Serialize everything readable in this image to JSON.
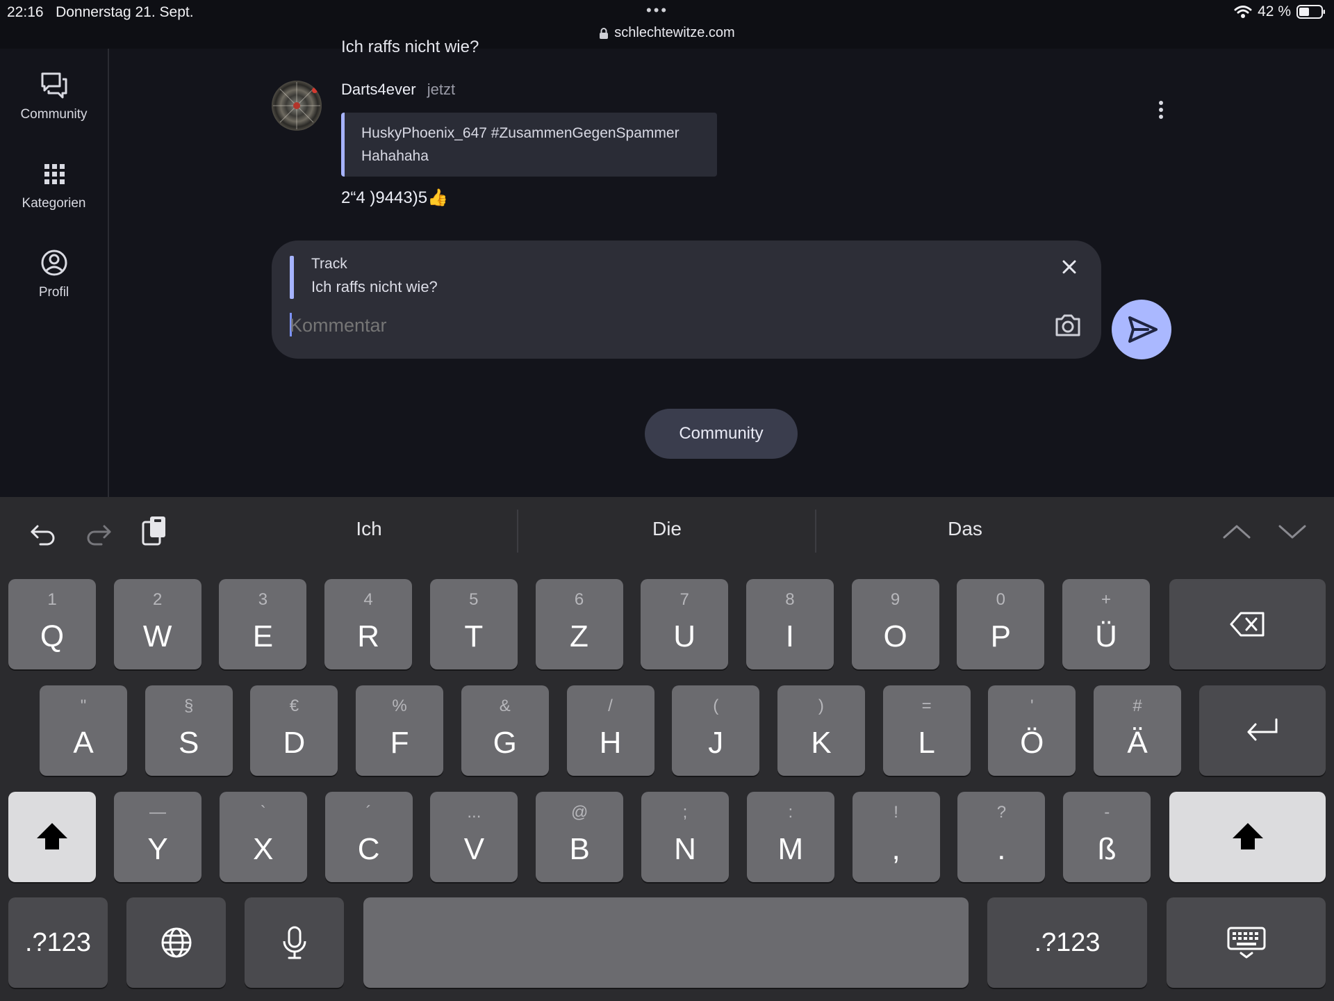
{
  "status": {
    "time": "22:16",
    "date": "Donnerstag 21. Sept.",
    "url": "schlechtewitze.com",
    "battery": "42 %"
  },
  "sidebar": {
    "items": [
      {
        "label": "Community",
        "icon": "forum-icon"
      },
      {
        "label": "Kategorien",
        "icon": "grid-icon"
      },
      {
        "label": "Profil",
        "icon": "account-circle-icon"
      }
    ]
  },
  "thread": {
    "cut_text": "Ich raffs nicht wie?",
    "comment": {
      "author": "Darts4ever",
      "time": "jetzt",
      "quote_line1": "HuskyPhoenix_647 #ZusammenGegenSpammer",
      "quote_line2": "Hahahaha",
      "body": "2“4 )9443)5👍"
    }
  },
  "composer": {
    "reply_to_user": "Track",
    "reply_to_text": "Ich raffs nicht wie?",
    "placeholder": "Kommentar"
  },
  "community_button": "Community",
  "keyboard": {
    "suggestions": [
      "Ich",
      "Die",
      "Das"
    ],
    "row1": [
      {
        "s": "1",
        "p": "Q"
      },
      {
        "s": "2",
        "p": "W"
      },
      {
        "s": "3",
        "p": "E"
      },
      {
        "s": "4",
        "p": "R"
      },
      {
        "s": "5",
        "p": "T"
      },
      {
        "s": "6",
        "p": "Z"
      },
      {
        "s": "7",
        "p": "U"
      },
      {
        "s": "8",
        "p": "I"
      },
      {
        "s": "9",
        "p": "O"
      },
      {
        "s": "0",
        "p": "P"
      },
      {
        "s": "+",
        "p": "Ü"
      }
    ],
    "row2": [
      {
        "s": "\"",
        "p": "A"
      },
      {
        "s": "§",
        "p": "S"
      },
      {
        "s": "€",
        "p": "D"
      },
      {
        "s": "%",
        "p": "F"
      },
      {
        "s": "&",
        "p": "G"
      },
      {
        "s": "/",
        "p": "H"
      },
      {
        "s": "(",
        "p": "J"
      },
      {
        "s": ")",
        "p": "K"
      },
      {
        "s": "=",
        "p": "L"
      },
      {
        "s": "'",
        "p": "Ö"
      },
      {
        "s": "#",
        "p": "Ä"
      }
    ],
    "row3": [
      {
        "s": "—",
        "p": "Y"
      },
      {
        "s": "`",
        "p": "X"
      },
      {
        "s": "´",
        "p": "C"
      },
      {
        "s": "...",
        "p": "V"
      },
      {
        "s": "@",
        "p": "B"
      },
      {
        "s": ";",
        "p": "N"
      },
      {
        "s": ":",
        "p": "M"
      },
      {
        "s": "!",
        "p": ","
      },
      {
        "s": "?",
        "p": "."
      },
      {
        "s": "-",
        "p": "ß"
      }
    ],
    "mode_key": ".?123"
  }
}
